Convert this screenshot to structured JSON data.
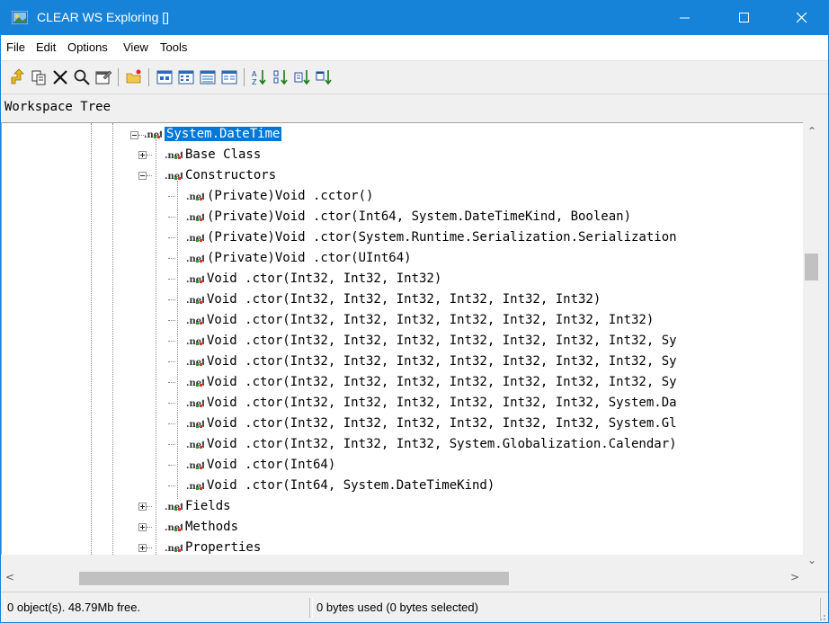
{
  "window": {
    "title": "CLEAR WS Exploring []"
  },
  "menu": [
    "File",
    "Edit",
    "Options",
    "View",
    "Tools"
  ],
  "toolbar_icons": [
    "navigate-up-icon",
    "copy-icon",
    "delete-icon",
    "find-icon",
    "properties-icon",
    "open-folder-icon",
    "view-large-icons-icon",
    "view-small-icons-icon",
    "view-list-icon",
    "view-details-icon",
    "sort-ascending-icon",
    "sort-descending-icon",
    "sort-by-type-icon",
    "sort-by-date-icon"
  ],
  "workspace_label": "Workspace Tree",
  "tree": {
    "root": "System.DateTime",
    "base_class": "Base Class",
    "constructors": "Constructors",
    "ctor_items": [
      "(Private)Void .cctor()",
      "(Private)Void .ctor(Int64, System.DateTimeKind, Boolean)",
      "(Private)Void .ctor(System.Runtime.Serialization.Serialization",
      "(Private)Void .ctor(UInt64)",
      "Void .ctor(Int32, Int32, Int32)",
      "Void .ctor(Int32, Int32, Int32, Int32, Int32, Int32)",
      "Void .ctor(Int32, Int32, Int32, Int32, Int32, Int32, Int32)",
      "Void .ctor(Int32, Int32, Int32, Int32, Int32, Int32, Int32, Sy",
      "Void .ctor(Int32, Int32, Int32, Int32, Int32, Int32, Int32, Sy",
      "Void .ctor(Int32, Int32, Int32, Int32, Int32, Int32, Int32, Sy",
      "Void .ctor(Int32, Int32, Int32, Int32, Int32, Int32, System.Da",
      "Void .ctor(Int32, Int32, Int32, Int32, Int32, Int32, System.Gl",
      "Void .ctor(Int32, Int32, Int32, System.Globalization.Calendar)",
      "Void .ctor(Int64)",
      "Void .ctor(Int64, System.DateTimeKind)"
    ],
    "fields": "Fields",
    "methods": "Methods",
    "properties": "Properties"
  },
  "status": {
    "left": "0 object(s). 48.79Mb free.",
    "right": "0 bytes used (0 bytes selected)"
  },
  "colors": {
    "titlebar": "#1783d8",
    "selection": "#0078d7"
  }
}
